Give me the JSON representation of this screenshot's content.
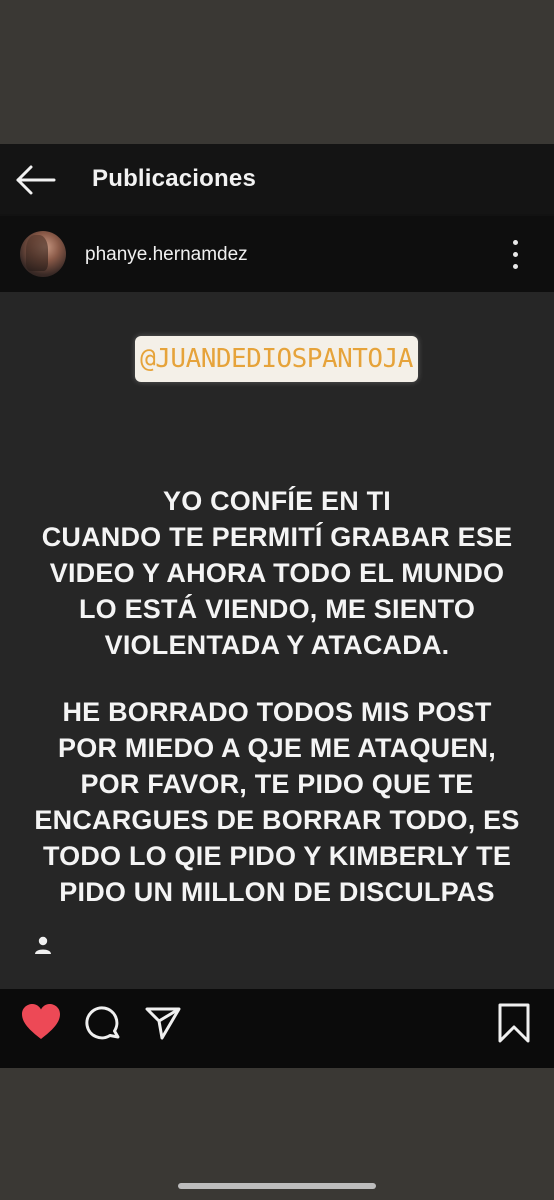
{
  "header": {
    "title": "Publicaciones",
    "back_icon": "arrow-left-icon"
  },
  "post": {
    "username": "phanye.hernamdez",
    "more_icon": "more-vertical-icon",
    "mention": "@JUANDEDIOSPANTOJA",
    "message_lines_1": [
      "YO CONFÍE EN TI",
      "CUANDO TE  PERMITÍ GRABAR ESE",
      "VIDEO Y AHORA TODO EL MUNDO",
      "LO ESTÁ VIENDO, ME SIENTO",
      "VIOLENTADA Y ATACADA."
    ],
    "message_lines_2": [
      "HE BORRADO TODOS MIS POST",
      "POR MIEDO A QJE ME ATAQUEN,",
      "POR FAVOR, TE PIDO QUE TE",
      "ENCARGUES DE BORRAR TODO, ES",
      "TODO LO QIE PIDO Y KIMBERLY TE",
      "PIDO UN MILLON DE DISCULPAS"
    ],
    "tag_icon": "person-tag-icon"
  },
  "actions": {
    "like_icon": "heart-filled-icon",
    "like_color": "#ed4956",
    "comment_icon": "comment-icon",
    "share_icon": "send-icon",
    "save_icon": "bookmark-icon"
  },
  "colors": {
    "background": "#121212",
    "post_background": "#262626",
    "mention_text": "#e6a33a",
    "mention_bg": "#f4f0e8"
  }
}
